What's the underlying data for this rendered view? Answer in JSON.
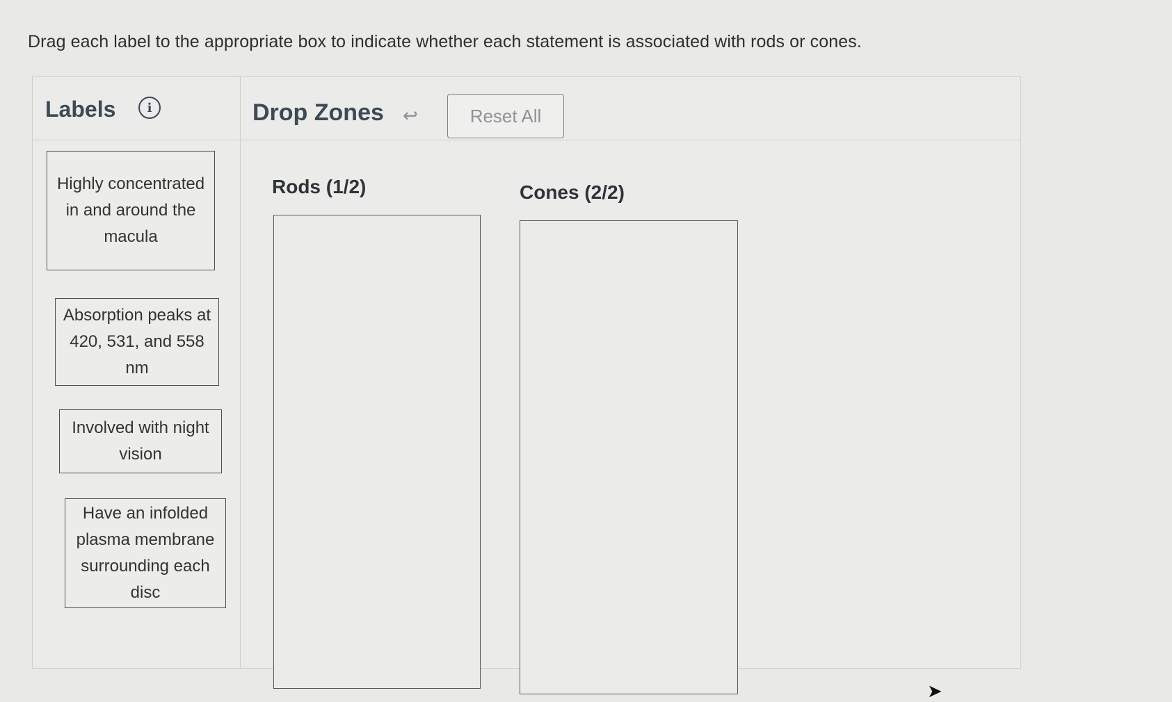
{
  "instructions": "Drag each label to the appropriate box to indicate whether each statement is associated with rods or cones.",
  "labels_panel": {
    "title": "Labels",
    "info_icon": "info-icon",
    "items": [
      {
        "text": "Highly concentrated in and around the macula"
      },
      {
        "text": "Absorption peaks at 420, 531, and 558 nm"
      },
      {
        "text": "Involved with night vision"
      },
      {
        "text": "Have an infolded plasma membrane surrounding each disc"
      }
    ]
  },
  "drop_panel": {
    "title": "Drop Zones",
    "undo_icon": "undo-arrow-icon",
    "reset_label": "Reset All",
    "zones": [
      {
        "title": "Rods (1/2)"
      },
      {
        "title": "Cones (2/2)"
      }
    ]
  }
}
